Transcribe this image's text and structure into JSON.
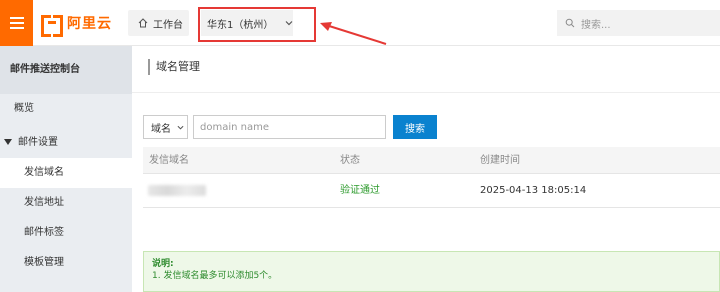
{
  "topbar": {
    "logo_text": "阿里云",
    "workspace_label": "工作台",
    "region_label": "华东1（杭州）",
    "search_placeholder": "搜索..."
  },
  "sidebar": {
    "title": "邮件推送控制台",
    "items": [
      {
        "label": "概览"
      },
      {
        "label": "邮件设置"
      },
      {
        "label": "发信域名"
      },
      {
        "label": "发信地址"
      },
      {
        "label": "邮件标签"
      },
      {
        "label": "模板管理"
      }
    ]
  },
  "main": {
    "title": "域名管理",
    "filter": {
      "select_value": "域名",
      "input_placeholder": "domain name",
      "search_label": "搜索"
    },
    "table": {
      "columns": [
        "发信域名",
        "状态",
        "创建时间"
      ],
      "rows": [
        {
          "domain": "",
          "status": "验证通过",
          "created": "2025-04-13 18:05:14"
        }
      ]
    },
    "notice": {
      "title": "说明:",
      "lines": [
        "1. 发信域名最多可以添加5个。"
      ]
    }
  },
  "colors": {
    "brand": "#ff6a00",
    "primary_button": "#0a82cf",
    "highlight": "#e53935",
    "success": "#2e9b2e"
  }
}
